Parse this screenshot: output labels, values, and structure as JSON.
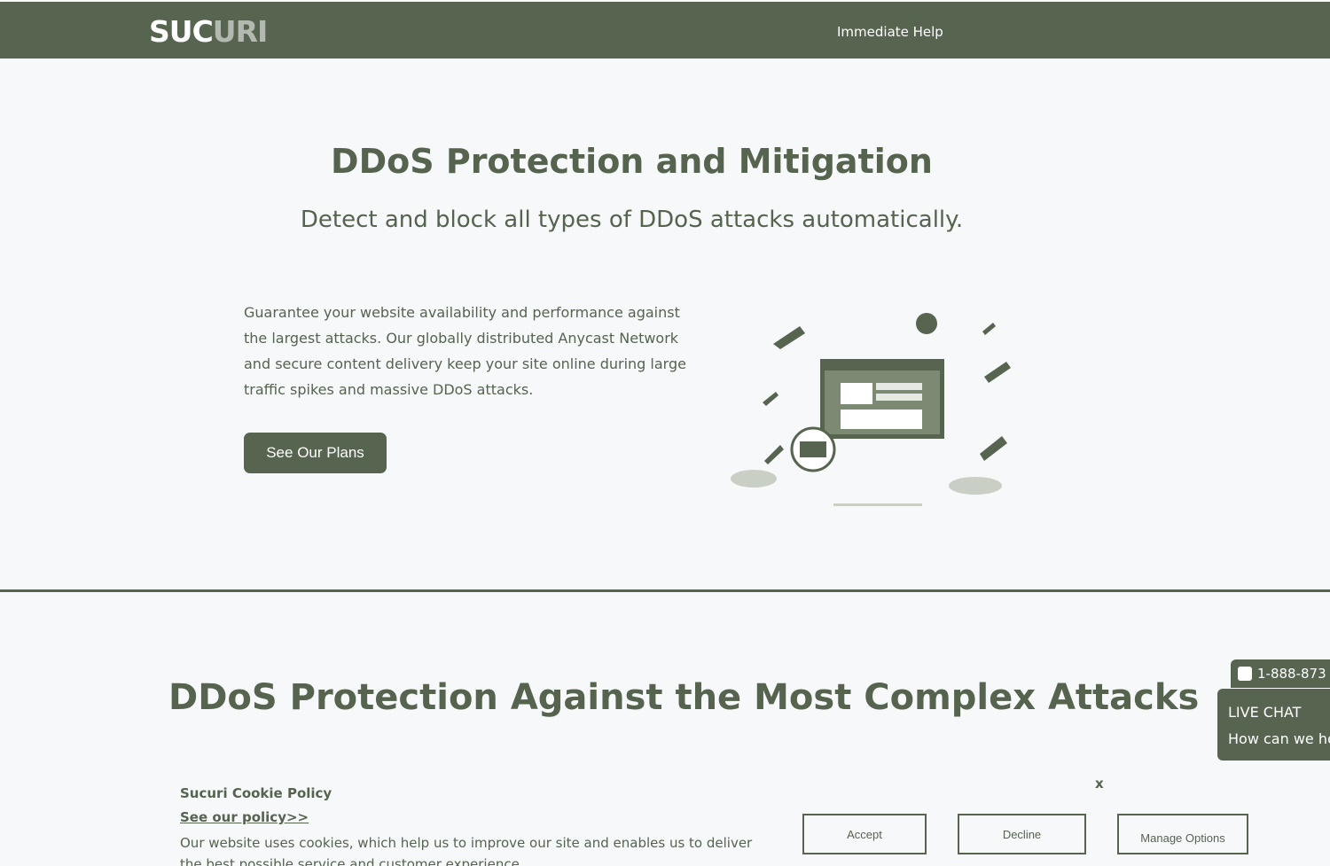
{
  "header": {
    "logo": "SUCURI",
    "nav_help": "Immediate Help"
  },
  "hero": {
    "title": "DDoS Protection and Mitigation",
    "subtitle": "Detect and block all types of DDoS attacks automatically.",
    "body": "Guarantee your website availability and performance against the largest attacks. Our globally distributed Anycast Network and secure content delivery keep your site online during large traffic spikes and massive DDoS attacks.",
    "cta_label": "See Our Plans",
    "illustration": "ddos-shield-illustration-icon"
  },
  "section2": {
    "title": "DDoS Protection Against the Most Complex Attacks"
  },
  "floating": {
    "phone": "1-888-873",
    "live_chat_title": "LIVE CHAT",
    "live_chat_sub": "How can we help"
  },
  "cookie": {
    "title": "Sucuri Cookie Policy",
    "link": "See our policy>>",
    "text": "Our website uses cookies, which help us to improve our site and enables us to deliver the best possible service and customer experience.",
    "close": "x",
    "accept": "Accept",
    "decline": "Decline",
    "manage": "Manage Options"
  },
  "colors": {
    "brand": "#566450",
    "background": "#f7f8fa",
    "text": "#55634f"
  }
}
